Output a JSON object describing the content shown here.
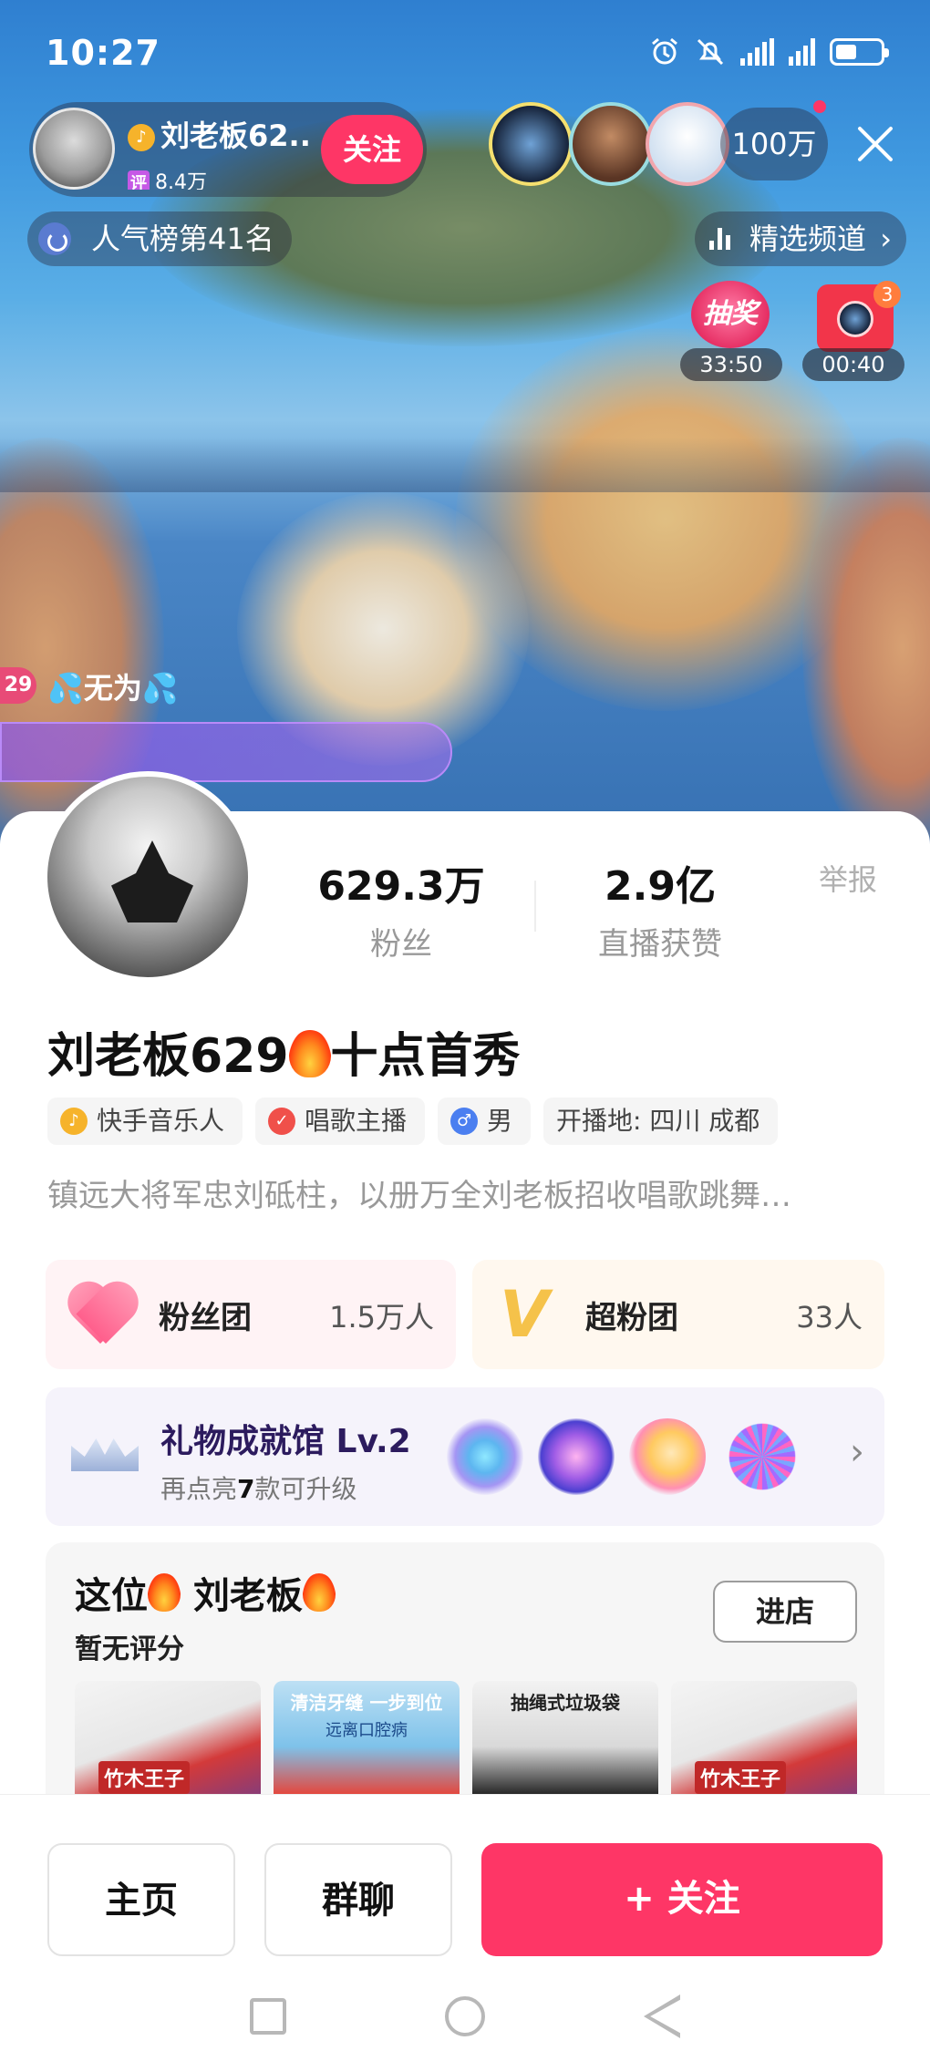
{
  "status_bar": {
    "time": "10:27"
  },
  "live_header": {
    "host_name": "刘老板62...",
    "host_sub_tag": "评",
    "host_sub_value": "8.4万",
    "follow_label": "关注",
    "viewer_count": "100万",
    "rank_label": "人气榜第41名",
    "channel_label": "精选频道",
    "lottery_label": "抽奖",
    "lottery_timer": "33:50",
    "redbox_count": "3",
    "redbox_timer": "00:40"
  },
  "chat": {
    "level": "29",
    "name": "无为"
  },
  "profile": {
    "report_label": "举报",
    "fans_value": "629.3万",
    "fans_label": "粉丝",
    "likes_value": "2.9亿",
    "likes_label": "直播获赞",
    "title_prefix": "刘老板629",
    "title_suffix": "十点首秀",
    "tags": [
      {
        "label": "快手音乐人",
        "icon": "music-icon",
        "color": "#f6b32b"
      },
      {
        "label": "唱歌主播",
        "icon": "verified-icon",
        "color": "#f0504a"
      },
      {
        "label": "男",
        "icon": "male-icon",
        "color": "#4b7ff0"
      },
      {
        "label": "开播地: 四川 成都"
      }
    ],
    "bio": "镇远大将军忠刘砥柱，以册万全刘老板招收唱歌跳舞…"
  },
  "fan_group": {
    "label": "粉丝团",
    "value": "1.5万人"
  },
  "super_fan_group": {
    "label": "超粉团",
    "value": "33人"
  },
  "gift_hall": {
    "title": "礼物成就馆 Lv.2",
    "sub_prefix": "再点亮",
    "sub_num": "7",
    "sub_suffix": "款可升级"
  },
  "shop": {
    "title_a": "这位",
    "title_b": "刘老板",
    "rating": "暂无评分",
    "enter_label": "进店",
    "products": [
      {
        "caption": "",
        "brand": "竹木王子"
      },
      {
        "caption": "清洁牙缝 一步到位",
        "caption2": "远离口腔病"
      },
      {
        "caption": "抽绳式垃圾袋"
      },
      {
        "caption": "",
        "brand": "竹木王子"
      }
    ]
  },
  "actions": {
    "home_label": "主页",
    "group_label": "群聊",
    "follow_label": "+ 关注"
  },
  "colors": {
    "accent": "#fe3666",
    "fan_card_bg": "#fff3f5",
    "super_card_bg": "#fff8ef",
    "gift_card_bg": "#f5f3fb"
  }
}
